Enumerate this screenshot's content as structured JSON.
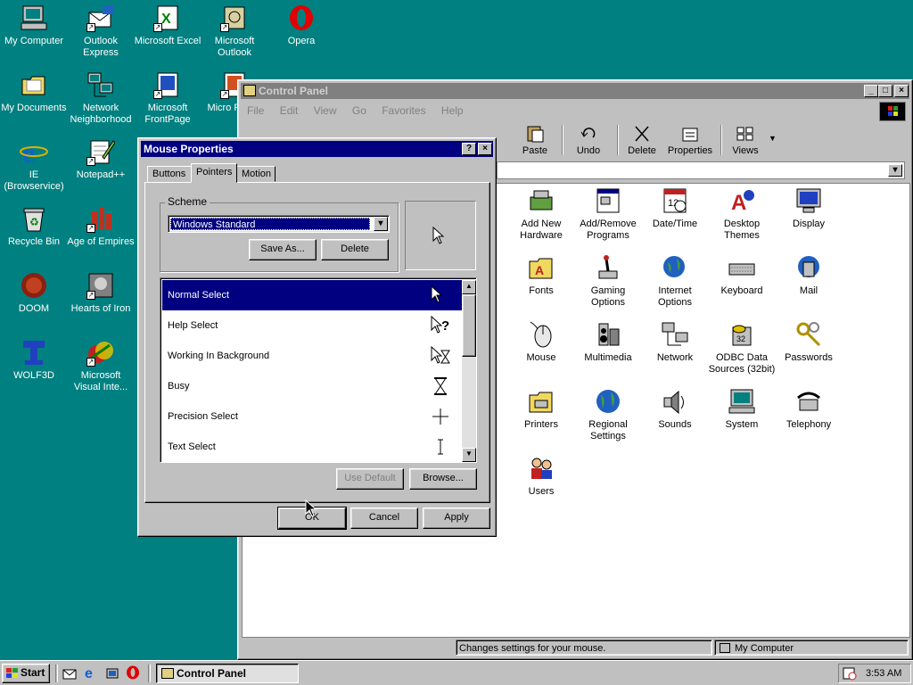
{
  "desktop_icons": [
    {
      "label": "My Computer"
    },
    {
      "label": "Outlook Express"
    },
    {
      "label": "Microsoft Excel"
    },
    {
      "label": "Microsoft Outlook"
    },
    {
      "label": "Opera"
    },
    {
      "label": "My Documents"
    },
    {
      "label": "Network Neighborhood"
    },
    {
      "label": "Microsoft FrontPage"
    },
    {
      "label": "Micro Power"
    },
    {
      "label": "IE (Browservice)"
    },
    {
      "label": "Notepad++"
    },
    {
      "label": "Recycle Bin"
    },
    {
      "label": "Age of Empires"
    },
    {
      "label": "DOOM"
    },
    {
      "label": "Hearts of Iron"
    },
    {
      "label": "WOLF3D"
    },
    {
      "label": "Microsoft Visual Inte..."
    }
  ],
  "control_panel": {
    "title": "Control Panel",
    "menu": [
      "File",
      "Edit",
      "View",
      "Go",
      "Favorites",
      "Help"
    ],
    "toolbar": [
      {
        "label": "Paste"
      },
      {
        "label": "Undo"
      },
      {
        "label": "Delete"
      },
      {
        "label": "Properties"
      },
      {
        "label": "Views"
      }
    ],
    "icons": [
      {
        "label": "Add New Hardware"
      },
      {
        "label": "Add/Remove Programs"
      },
      {
        "label": "Date/Time"
      },
      {
        "label": "Desktop Themes"
      },
      {
        "label": "Display"
      },
      {
        "label": "Fonts"
      },
      {
        "label": "Gaming Options"
      },
      {
        "label": "Internet Options"
      },
      {
        "label": "Keyboard"
      },
      {
        "label": "Mail"
      },
      {
        "label": "Mouse"
      },
      {
        "label": "Multimedia"
      },
      {
        "label": "Network"
      },
      {
        "label": "ODBC Data Sources (32bit)"
      },
      {
        "label": "Passwords"
      },
      {
        "label": "Printers"
      },
      {
        "label": "Regional Settings"
      },
      {
        "label": "Sounds"
      },
      {
        "label": "System"
      },
      {
        "label": "Telephony"
      },
      {
        "label": "Users"
      }
    ],
    "status_text": "Changes settings for your mouse.",
    "status_zone": "My Computer"
  },
  "dialog": {
    "title": "Mouse Properties",
    "tabs": [
      "Buttons",
      "Pointers",
      "Motion"
    ],
    "active_tab": "Pointers",
    "scheme_label": "Scheme",
    "scheme_value": "Windows Standard",
    "save_as": "Save As...",
    "delete": "Delete",
    "pointers": [
      {
        "label": "Normal Select"
      },
      {
        "label": "Help Select"
      },
      {
        "label": "Working In Background"
      },
      {
        "label": "Busy"
      },
      {
        "label": "Precision Select"
      },
      {
        "label": "Text Select"
      }
    ],
    "selected_pointer": "Normal Select",
    "use_default": "Use Default",
    "browse": "Browse...",
    "ok": "OK",
    "cancel": "Cancel",
    "apply": "Apply"
  },
  "taskbar": {
    "start": "Start",
    "task": "Control Panel",
    "clock": "3:53 AM"
  },
  "colors": {
    "desktop": "#008080",
    "titlebar": "#000080",
    "inactive_title": "#808080",
    "face": "#c0c0c0"
  }
}
